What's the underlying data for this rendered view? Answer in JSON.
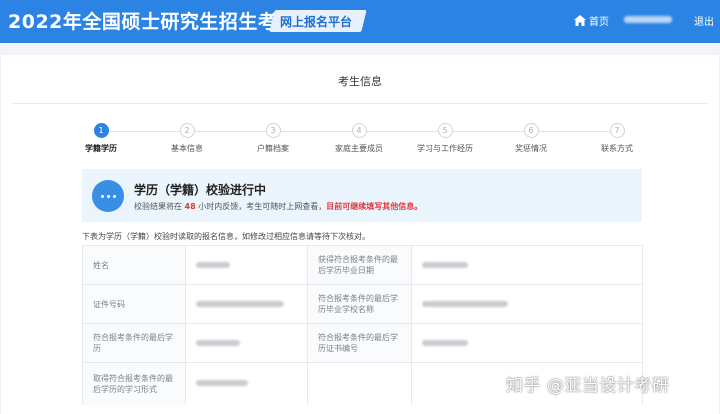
{
  "header": {
    "title": "2022年全国硕士研究生招生考试",
    "platform_label": "网上报名平台",
    "home_label": "首页",
    "logout_label": "退出"
  },
  "section": {
    "title": "考生信息"
  },
  "steps": [
    {
      "num": "1",
      "label": "学籍学历"
    },
    {
      "num": "2",
      "label": "基本信息"
    },
    {
      "num": "3",
      "label": "户籍档案"
    },
    {
      "num": "4",
      "label": "家庭主要成员"
    },
    {
      "num": "5",
      "label": "学习与工作经历"
    },
    {
      "num": "6",
      "label": "奖惩情况"
    },
    {
      "num": "7",
      "label": "联系方式"
    }
  ],
  "info": {
    "title": "学历（学籍）校验进行中",
    "line_prefix": "校验结果将在",
    "hours": "48",
    "line_middle": "小时内反馈，考生可随时上网查看，",
    "line_warning": "目前可继续填写其他信息。"
  },
  "note": "下表为学历（学籍）校验时读取的报名信息，如修改过相应信息请等待下次核对。",
  "table": {
    "rows": [
      {
        "left_label": "姓名",
        "right_label": "获得符合报考条件的最后学历毕业日期"
      },
      {
        "left_label": "证件号码",
        "right_label": "符合报考条件的最后学历毕业学校名称"
      },
      {
        "left_label": "符合报考条件的最后学历",
        "right_label": "符合报考条件的最后学历证书编号"
      },
      {
        "left_label": "取得符合报考条件的最后学历的学习形式",
        "right_label": ""
      }
    ]
  },
  "watermark": "知乎 @亚当设计考研",
  "colors": {
    "header_blue": "#2b83e3",
    "step_active": "#2b83e3",
    "info_bg": "#eaf5fd",
    "warning_red": "#e4393c"
  },
  "icons": {
    "home": "home-icon",
    "progress": "more-dots-icon"
  }
}
